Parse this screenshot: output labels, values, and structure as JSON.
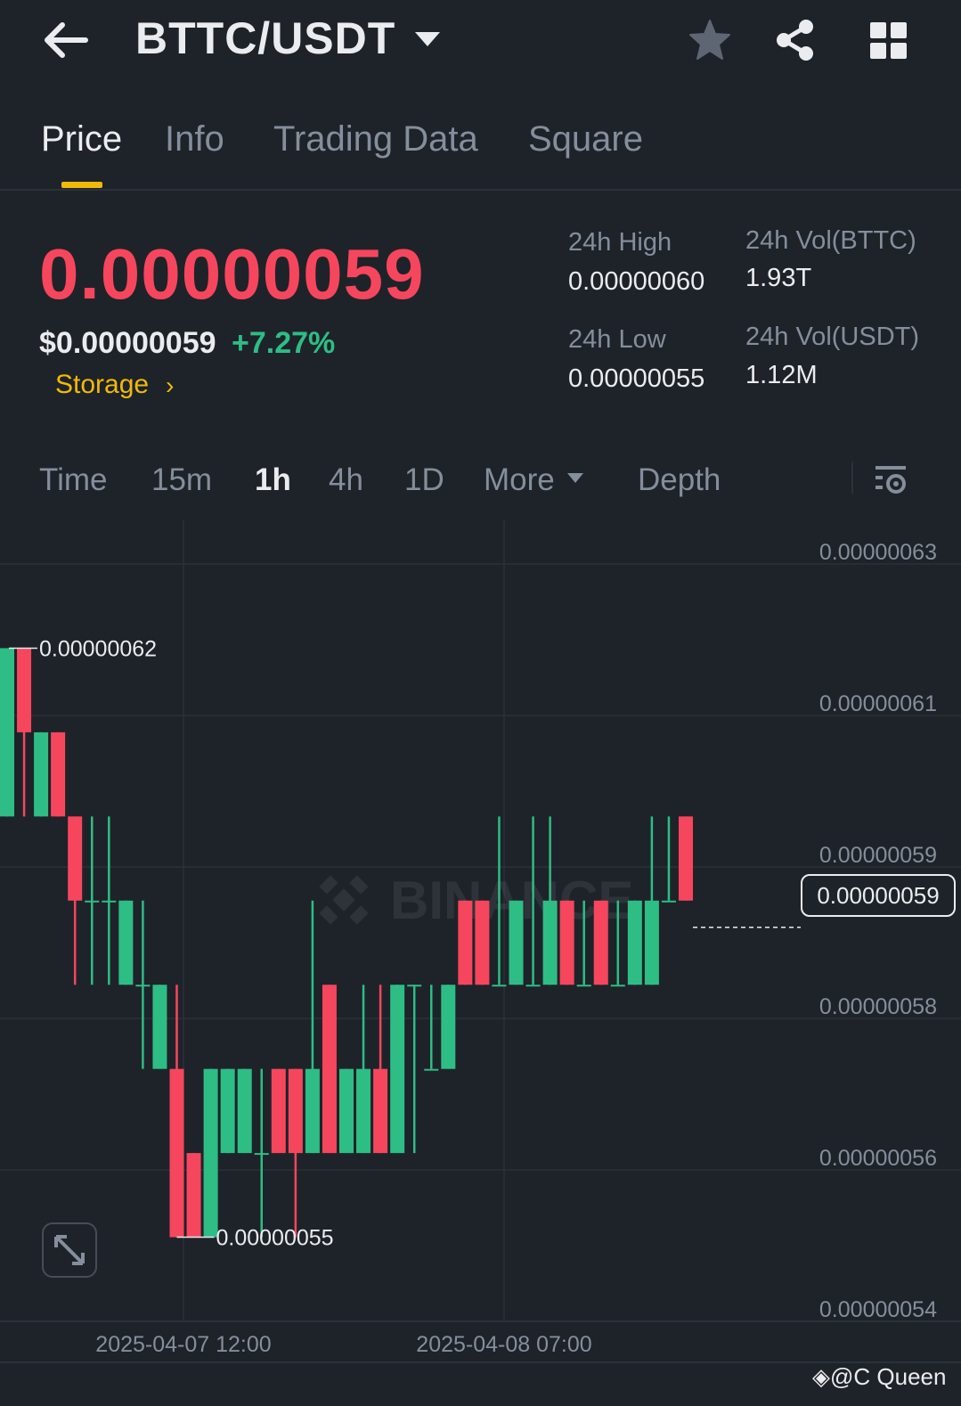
{
  "header": {
    "pair": "BTTC/USDT",
    "icons": [
      "back-arrow-icon",
      "caret-down-icon",
      "star-icon",
      "share-icon",
      "grid-icon"
    ]
  },
  "tabs": [
    {
      "label": "Price",
      "active": true
    },
    {
      "label": "Info",
      "active": false
    },
    {
      "label": "Trading Data",
      "active": false
    },
    {
      "label": "Square",
      "active": false
    }
  ],
  "price": {
    "last": "0.00000059",
    "usd": "$0.00000059",
    "change": "+7.27%",
    "tag": "Storage"
  },
  "stats": {
    "high_label": "24h High",
    "high_value": "0.00000060",
    "low_label": "24h Low",
    "low_value": "0.00000055",
    "vol_base_label": "24h Vol(BTTC)",
    "vol_base_value": "1.93T",
    "vol_quote_label": "24h Vol(USDT)",
    "vol_quote_value": "1.12M"
  },
  "intervals": {
    "items": [
      "Time",
      "15m",
      "1h",
      "4h",
      "1D",
      "More",
      "Depth"
    ],
    "active": "1h"
  },
  "colors": {
    "up": "#2ebd85",
    "down": "#f6465d",
    "accent": "#f0b90b",
    "background": "#1e2329"
  },
  "chart_data": {
    "type": "candlestick",
    "y_ticks": [
      "0.00000063",
      "0.00000061",
      "0.00000059",
      "0.00000058",
      "0.00000056",
      "0.00000054"
    ],
    "x_ticks": [
      "2025-04-07 12:00",
      "2025-04-08 07:00"
    ],
    "high_marker": "0.00000062",
    "low_marker": "0.00000055",
    "current_price": "0.00000059",
    "watermark": "BINANCE",
    "grid": true,
    "candles": [
      {
        "o": 6e-07,
        "h": 6.2e-07,
        "l": 6e-07,
        "c": 6.2e-07
      },
      {
        "o": 6.2e-07,
        "h": 6.2e-07,
        "l": 6e-07,
        "c": 6.1e-07
      },
      {
        "o": 6e-07,
        "h": 6.1e-07,
        "l": 6e-07,
        "c": 6.1e-07
      },
      {
        "o": 6.1e-07,
        "h": 6.1e-07,
        "l": 6e-07,
        "c": 6e-07
      },
      {
        "o": 6e-07,
        "h": 6e-07,
        "l": 5.8e-07,
        "c": 5.9e-07
      },
      {
        "o": 5.9e-07,
        "h": 6e-07,
        "l": 5.8e-07,
        "c": 5.9e-07
      },
      {
        "o": 5.9e-07,
        "h": 6e-07,
        "l": 5.8e-07,
        "c": 5.9e-07
      },
      {
        "o": 5.8e-07,
        "h": 5.9e-07,
        "l": 5.8e-07,
        "c": 5.9e-07
      },
      {
        "o": 5.8e-07,
        "h": 5.9e-07,
        "l": 5.7e-07,
        "c": 5.8e-07
      },
      {
        "o": 5.7e-07,
        "h": 5.8e-07,
        "l": 5.7e-07,
        "c": 5.8e-07
      },
      {
        "o": 5.7e-07,
        "h": 5.8e-07,
        "l": 5.5e-07,
        "c": 5.5e-07
      },
      {
        "o": 5.6e-07,
        "h": 5.6e-07,
        "l": 5.5e-07,
        "c": 5.5e-07
      },
      {
        "o": 5.5e-07,
        "h": 5.7e-07,
        "l": 5.5e-07,
        "c": 5.7e-07
      },
      {
        "o": 5.6e-07,
        "h": 5.7e-07,
        "l": 5.6e-07,
        "c": 5.7e-07
      },
      {
        "o": 5.6e-07,
        "h": 5.7e-07,
        "l": 5.6e-07,
        "c": 5.7e-07
      },
      {
        "o": 5.6e-07,
        "h": 5.7e-07,
        "l": 5.5e-07,
        "c": 5.6e-07
      },
      {
        "o": 5.7e-07,
        "h": 5.7e-07,
        "l": 5.6e-07,
        "c": 5.6e-07
      },
      {
        "o": 5.7e-07,
        "h": 5.7e-07,
        "l": 5.5e-07,
        "c": 5.6e-07
      },
      {
        "o": 5.6e-07,
        "h": 5.9e-07,
        "l": 5.6e-07,
        "c": 5.7e-07
      },
      {
        "o": 5.8e-07,
        "h": 5.8e-07,
        "l": 5.6e-07,
        "c": 5.6e-07
      },
      {
        "o": 5.6e-07,
        "h": 5.7e-07,
        "l": 5.6e-07,
        "c": 5.7e-07
      },
      {
        "o": 5.6e-07,
        "h": 5.8e-07,
        "l": 5.6e-07,
        "c": 5.7e-07
      },
      {
        "o": 5.7e-07,
        "h": 5.8e-07,
        "l": 5.6e-07,
        "c": 5.6e-07
      },
      {
        "o": 5.6e-07,
        "h": 5.8e-07,
        "l": 5.6e-07,
        "c": 5.8e-07
      },
      {
        "o": 5.8e-07,
        "h": 5.8e-07,
        "l": 5.6e-07,
        "c": 5.8e-07
      },
      {
        "o": 5.7e-07,
        "h": 5.8e-07,
        "l": 5.7e-07,
        "c": 5.7e-07
      },
      {
        "o": 5.7e-07,
        "h": 5.8e-07,
        "l": 5.7e-07,
        "c": 5.8e-07
      },
      {
        "o": 5.9e-07,
        "h": 5.9e-07,
        "l": 5.8e-07,
        "c": 5.8e-07
      },
      {
        "o": 5.9e-07,
        "h": 5.9e-07,
        "l": 5.8e-07,
        "c": 5.8e-07
      },
      {
        "o": 5.8e-07,
        "h": 6e-07,
        "l": 5.8e-07,
        "c": 5.8e-07
      },
      {
        "o": 5.8e-07,
        "h": 5.9e-07,
        "l": 5.8e-07,
        "c": 5.9e-07
      },
      {
        "o": 5.8e-07,
        "h": 6e-07,
        "l": 5.8e-07,
        "c": 5.8e-07
      },
      {
        "o": 5.8e-07,
        "h": 6e-07,
        "l": 5.8e-07,
        "c": 5.9e-07
      },
      {
        "o": 5.9e-07,
        "h": 5.9e-07,
        "l": 5.8e-07,
        "c": 5.8e-07
      },
      {
        "o": 5.8e-07,
        "h": 5.9e-07,
        "l": 5.8e-07,
        "c": 5.8e-07
      },
      {
        "o": 5.9e-07,
        "h": 5.9e-07,
        "l": 5.8e-07,
        "c": 5.8e-07
      },
      {
        "o": 5.8e-07,
        "h": 5.9e-07,
        "l": 5.8e-07,
        "c": 5.8e-07
      },
      {
        "o": 5.8e-07,
        "h": 5.9e-07,
        "l": 5.8e-07,
        "c": 5.9e-07
      },
      {
        "o": 5.8e-07,
        "h": 6e-07,
        "l": 5.8e-07,
        "c": 5.9e-07
      },
      {
        "o": 5.9e-07,
        "h": 6e-07,
        "l": 5.9e-07,
        "c": 5.9e-07
      },
      {
        "o": 6e-07,
        "h": 6e-07,
        "l": 5.9e-07,
        "c": 5.9e-07
      }
    ]
  },
  "footer": {
    "credit": "@C Queen"
  }
}
